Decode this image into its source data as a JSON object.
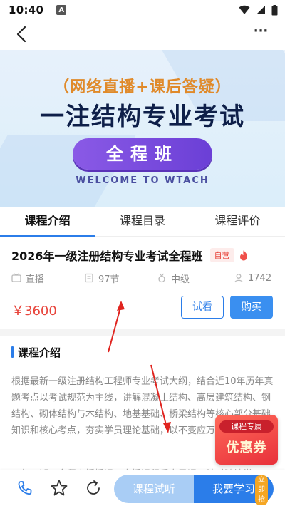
{
  "status": {
    "time": "10:40",
    "notif_letter": "A"
  },
  "banner": {
    "line1": "（网络直播+课后答疑）",
    "line2": "一注结构专业考试",
    "pill": "全程班",
    "welcome": "WELCOME TO WTACH"
  },
  "tabs": [
    "课程介绍",
    "课程目录",
    "课程评价"
  ],
  "course": {
    "title": "2026年一级注册结构专业考试全程班",
    "badge": "自营",
    "meta": {
      "type": "直播",
      "lessons": "97节",
      "level": "中级",
      "students": "1742"
    },
    "price": "￥3600",
    "trial_button": "试看",
    "buy_button": "购买"
  },
  "intro": {
    "title": "课程介绍",
    "text": "根据最新一级注册结构工程师专业考试大纲，结合近10年历年真题考点以考试规范为主线，讲解混凝土结构、高层建筑结构、钢结构、砌体结构与木结构、地基基础、桥梁结构等核心部分基础知识和核心考点，夯实学员理论基础，以不变应万变。",
    "more": "一年一期，全程直播授课，直播课程后自己课，随时随地学习"
  },
  "coupon": {
    "top": "课程专属",
    "big": "优惠券",
    "grab": "立即抢"
  },
  "bottom": {
    "trial": "课程试听",
    "learn": "我要学习"
  },
  "colors": {
    "accent": "#2b7de9",
    "price": "#e8453c",
    "annotation": "#e0241f"
  }
}
